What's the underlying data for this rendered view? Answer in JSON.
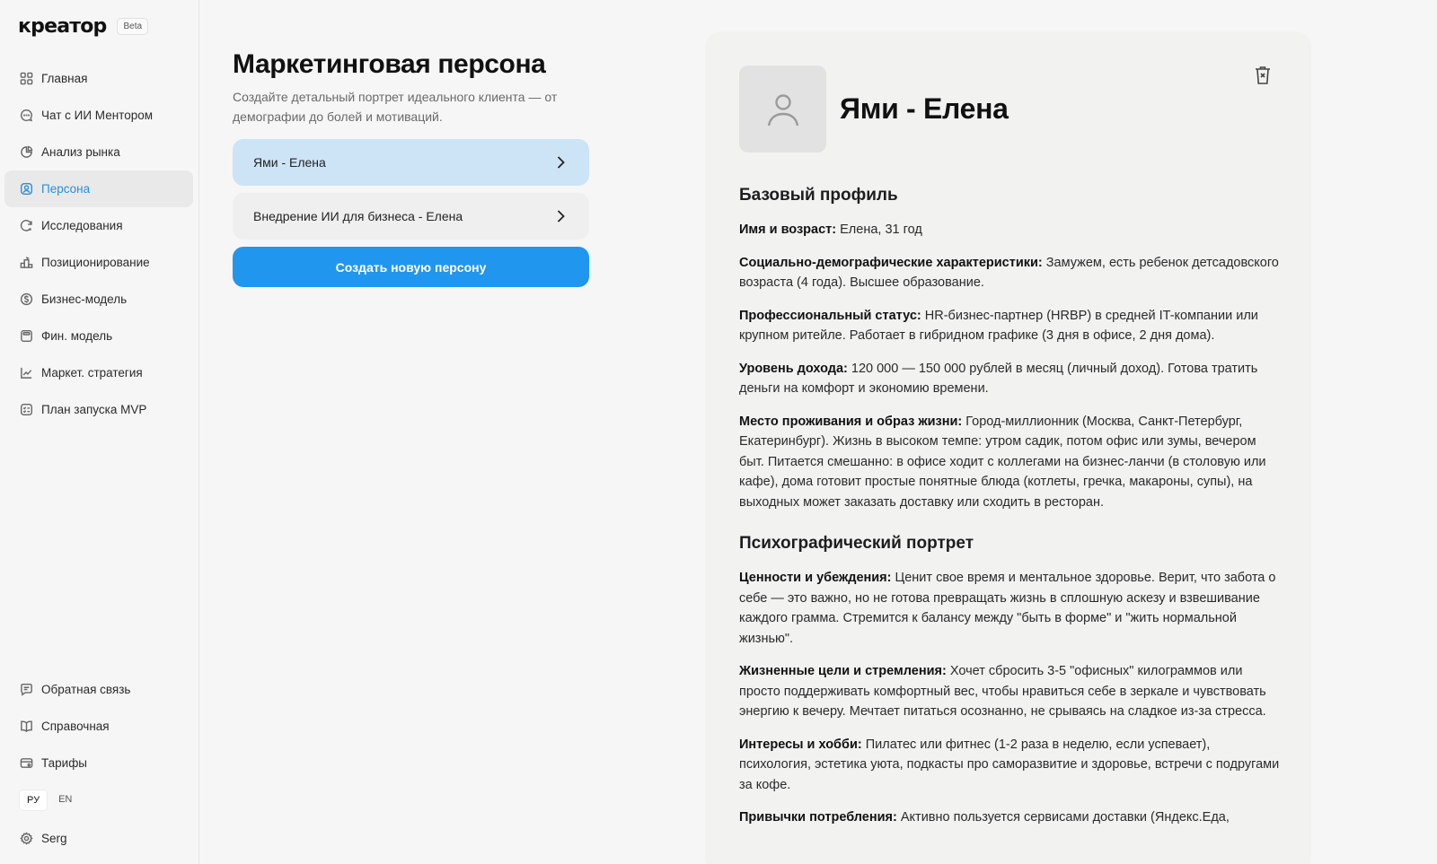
{
  "brand": {
    "logo": "креатор",
    "badge": "Beta"
  },
  "sidebar": {
    "items": [
      {
        "label": "Главная",
        "icon": "grid-icon"
      },
      {
        "label": "Чат с ИИ Ментором",
        "icon": "chat-icon"
      },
      {
        "label": "Анализ рынка",
        "icon": "pie-chart-icon"
      },
      {
        "label": "Персона",
        "icon": "user-square-icon",
        "active": true
      },
      {
        "label": "Исследования",
        "icon": "refresh-search-icon"
      },
      {
        "label": "Позиционирование",
        "icon": "podium-icon"
      },
      {
        "label": "Бизнес-модель",
        "icon": "dollar-circle-icon"
      },
      {
        "label": "Фин. модель",
        "icon": "calculator-icon"
      },
      {
        "label": "Маркет. стратегия",
        "icon": "line-chart-icon"
      },
      {
        "label": "План запуска MVP",
        "icon": "checklist-icon"
      }
    ],
    "bottom": [
      {
        "label": "Обратная связь",
        "icon": "feedback-icon"
      },
      {
        "label": "Справочная",
        "icon": "book-icon"
      },
      {
        "label": "Тарифы",
        "icon": "card-icon"
      }
    ],
    "languages": [
      "РУ",
      "EN"
    ],
    "active_language": "РУ",
    "user": {
      "name": "Serg",
      "icon": "gear-icon"
    }
  },
  "main": {
    "title": "Маркетинговая персона",
    "subtitle": "Создайте детальный портрет идеального клиента — от демографии до болей и мотиваций.",
    "personas": [
      "Ями - Елена",
      "Внедрение ИИ для бизнеса - Елена"
    ],
    "create_button": "Создать новую персону"
  },
  "detail": {
    "name": "Ями - Елена",
    "sections": [
      {
        "heading": "Базовый профиль",
        "fields": [
          {
            "label": "Имя и возраст:",
            "text": "Елена, 31 год"
          },
          {
            "label": "Социально-демографические характеристики:",
            "text": "Замужем, есть ребенок детсадовского возраста (4 года). Высшее образование."
          },
          {
            "label": "Профессиональный статус:",
            "text": "HR-бизнес-партнер (HRBP) в средней IT-компании или крупном ритейле. Работает в гибридном графике (3 дня в офисе, 2 дня дома)."
          },
          {
            "label": "Уровень дохода:",
            "text": "120 000 — 150 000 рублей в месяц (личный доход). Готова тратить деньги на комфорт и экономию времени."
          },
          {
            "label": "Место проживания и образ жизни:",
            "text": "Город-миллионник (Москва, Санкт-Петербург, Екатеринбург). Жизнь в высоком темпе: утром садик, потом офис или зумы, вечером быт. Питается смешанно: в офисе ходит с коллегами на бизнес-ланчи (в столовую или кафе), дома готовит простые понятные блюда (котлеты, гречка, макароны, супы), на выходных может заказать доставку или сходить в ресторан."
          }
        ]
      },
      {
        "heading": "Психографический портрет",
        "fields": [
          {
            "label": "Ценности и убеждения:",
            "text": "Ценит свое время и ментальное здоровье. Верит, что забота о себе — это важно, но не готова превращать жизнь в сплошную аскезу и взвешивание каждого грамма. Стремится к балансу между \"быть в форме\" и \"жить нормальной жизнью\"."
          },
          {
            "label": "Жизненные цели и стремления:",
            "text": "Хочет сбросить 3-5 \"офисных\" килограммов или просто поддерживать комфортный вес, чтобы нравиться себе в зеркале и чувствовать энергию к вечеру. Мечтает питаться осознанно, не срываясь на сладкое из-за стресса."
          },
          {
            "label": "Интересы и хобби:",
            "text": "Пилатес или фитнес (1-2 раза в неделю, если успевает), психология, эстетика уюта, подкасты про саморазвитие и здоровье, встречи с подругами за кофе."
          },
          {
            "label": "Привычки потребления:",
            "text": "Активно пользуется сервисами доставки (Яндекс.Еда,"
          }
        ]
      }
    ]
  }
}
